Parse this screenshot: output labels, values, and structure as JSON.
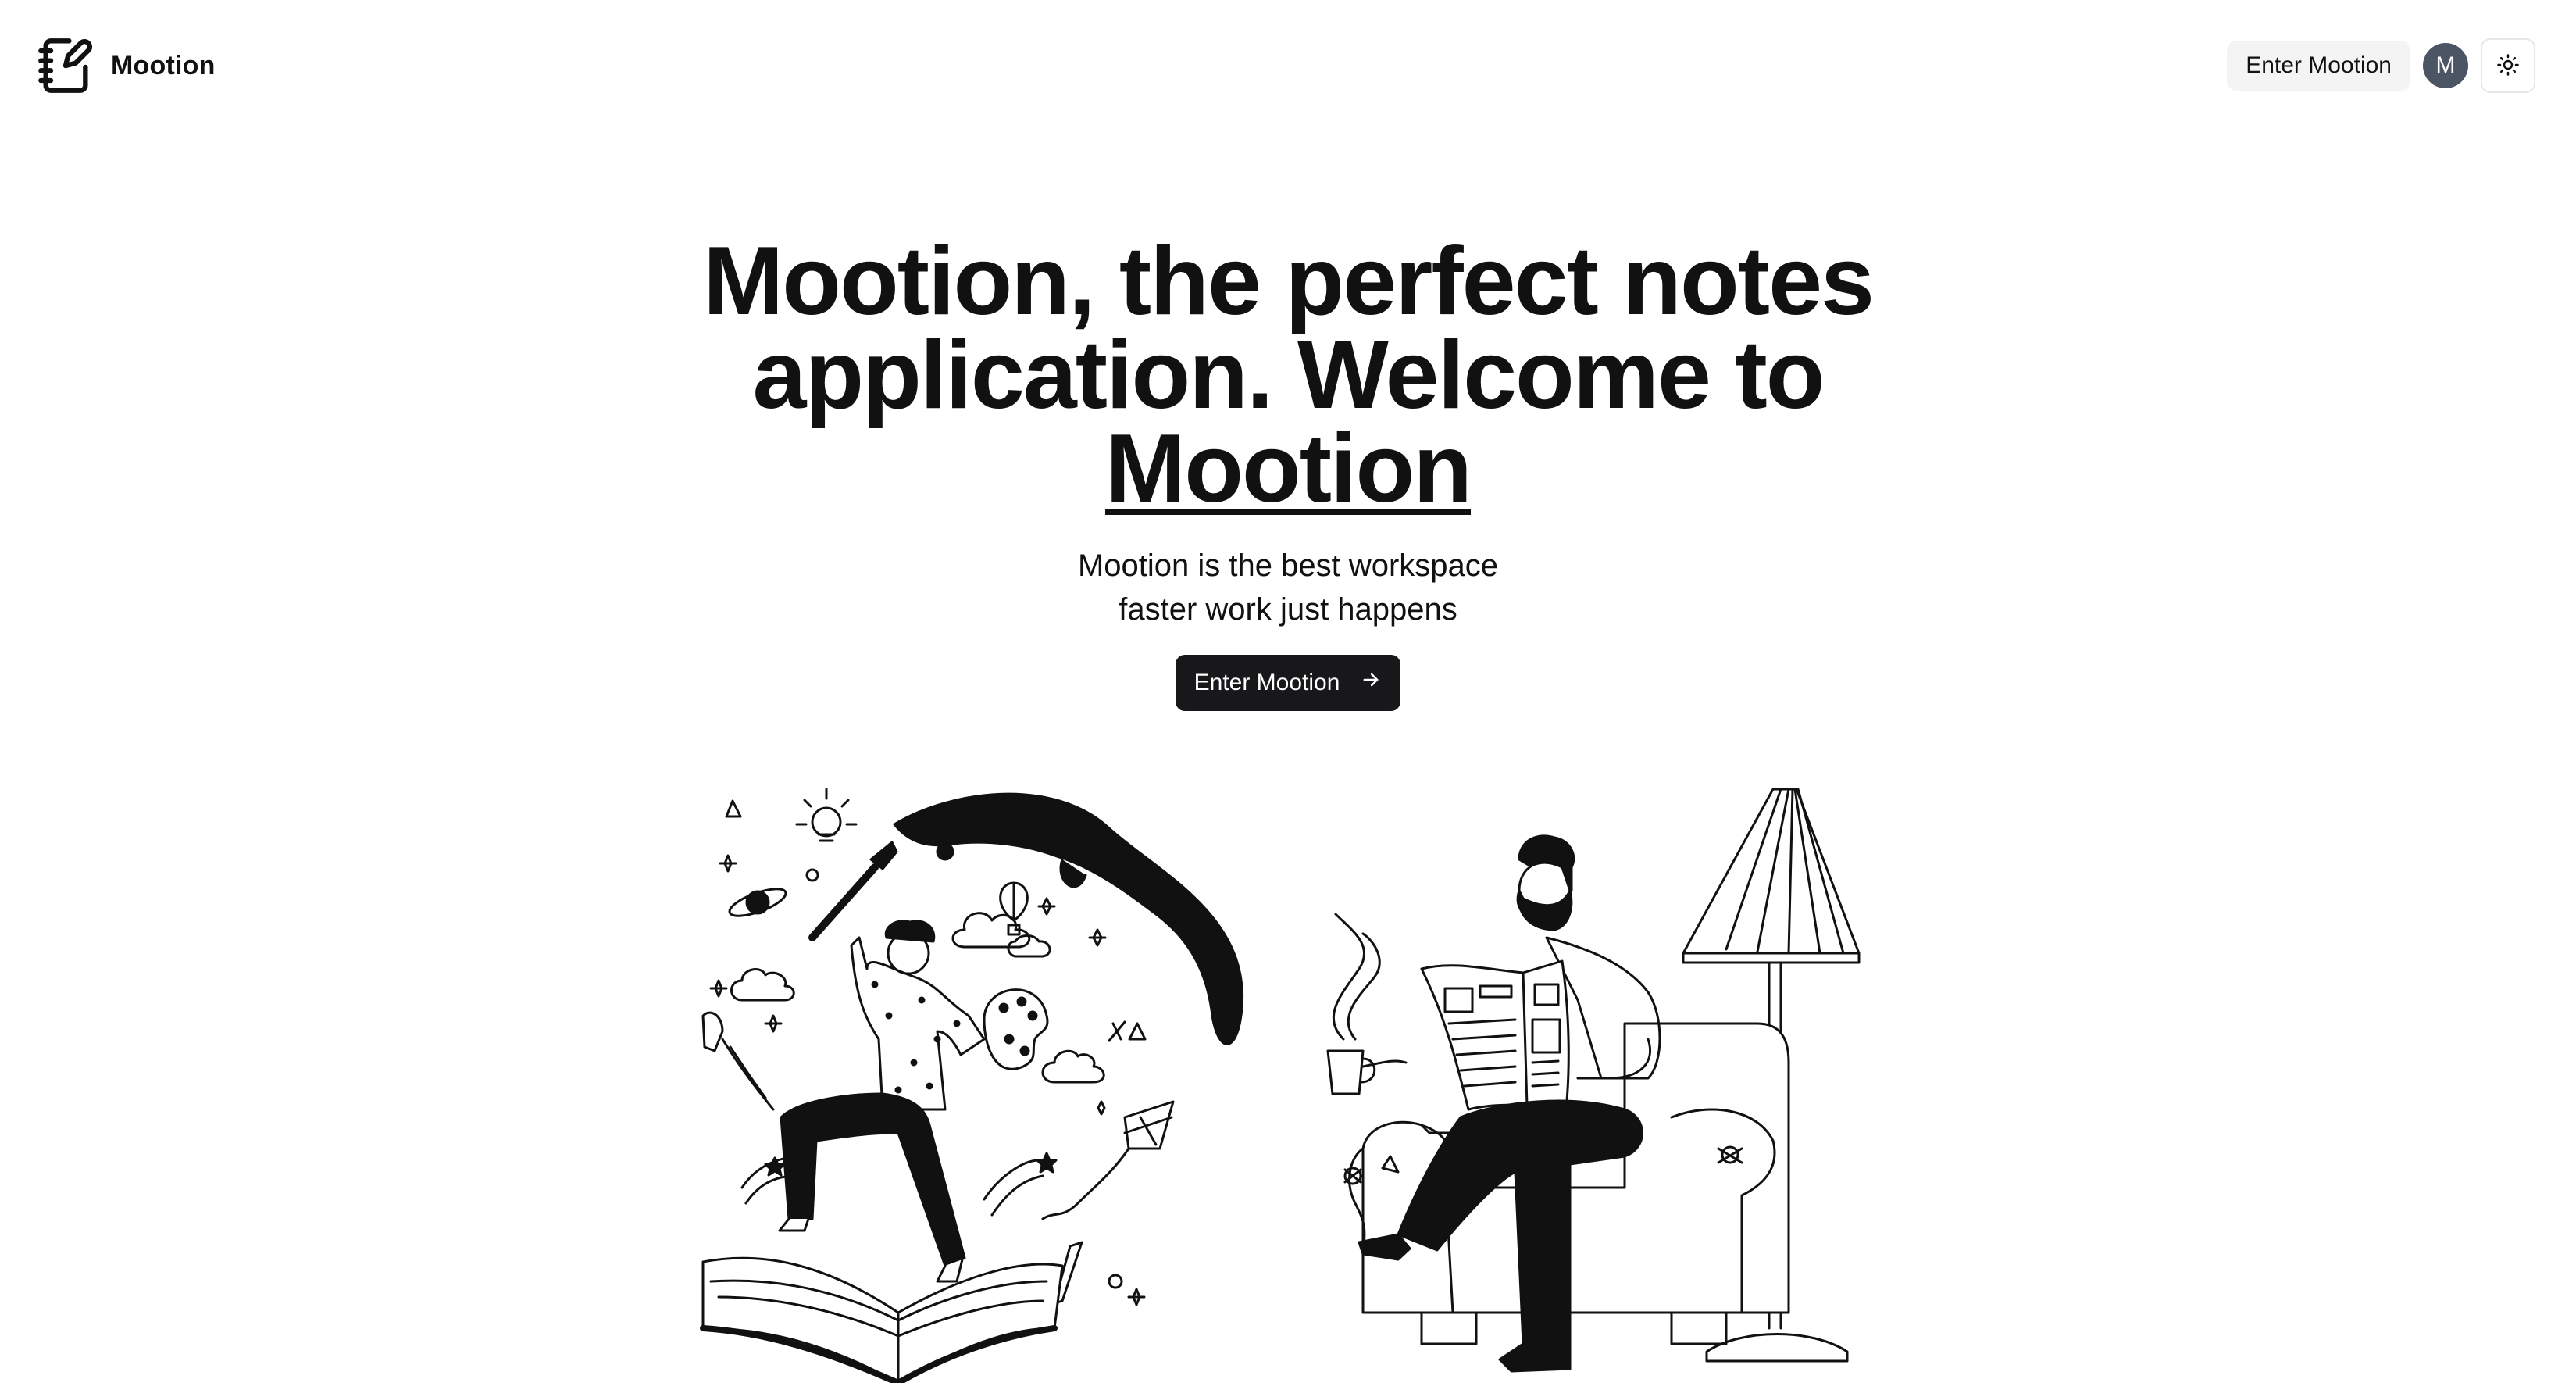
{
  "header": {
    "brand_name": "Mootion",
    "enter_label": "Enter Mootion",
    "avatar_initial": "M"
  },
  "hero": {
    "title_line": "Mootion, the perfect notes application. Welcome to",
    "title_brand": "Mootion",
    "subtitle_line1": "Mootion is the best workspace",
    "subtitle_line2": "faster work just happens",
    "cta_label": "Enter Mootion"
  },
  "icons": {
    "logo": "notebook-pen-icon",
    "theme": "sun-icon",
    "cta_arrow": "arrow-right-icon"
  },
  "colors": {
    "background": "#ffffff",
    "text": "#111111",
    "primary_button": "#18181b",
    "ghost_button": "#f4f4f5",
    "avatar": "#4b5563"
  }
}
